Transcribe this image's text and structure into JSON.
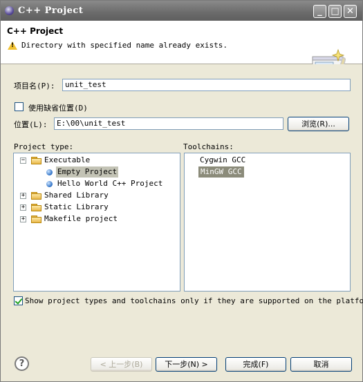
{
  "window": {
    "title": "C++ Project"
  },
  "header": {
    "title": "C++ Project",
    "message": "Directory with specified name already exists."
  },
  "form": {
    "project_name_label": "项目名(P):",
    "project_name_value": "unit_test",
    "use_default_label": "使用缺省位置(D)",
    "use_default_checked": false,
    "location_label": "位置(L):",
    "location_value": "E:\\00\\unit_test",
    "browse_label": "浏览(R)..."
  },
  "project_type": {
    "label": "Project type:",
    "items": [
      {
        "label": "Executable",
        "expanded": true
      },
      {
        "label": "Empty Project",
        "selected": true
      },
      {
        "label": "Hello World C++ Project"
      },
      {
        "label": "Shared Library",
        "expanded": false
      },
      {
        "label": "Static Library",
        "expanded": false
      },
      {
        "label": "Makefile project",
        "expanded": false
      }
    ]
  },
  "toolchains": {
    "label": "Toolchains:",
    "items": [
      {
        "label": "Cygwin GCC"
      },
      {
        "label": "MinGW GCC",
        "selected": true
      }
    ]
  },
  "filter": {
    "label": "Show project types and toolchains only if they are supported on the platform",
    "checked": true
  },
  "buttons": {
    "back": "< 上一步(B)",
    "next": "下一步(N) >",
    "finish": "完成(F)",
    "cancel": "取消"
  },
  "icons": {
    "app": "eclipse-icon",
    "warning": "warning-icon",
    "banner": "wizard-banner-icon",
    "help": "help-icon"
  }
}
